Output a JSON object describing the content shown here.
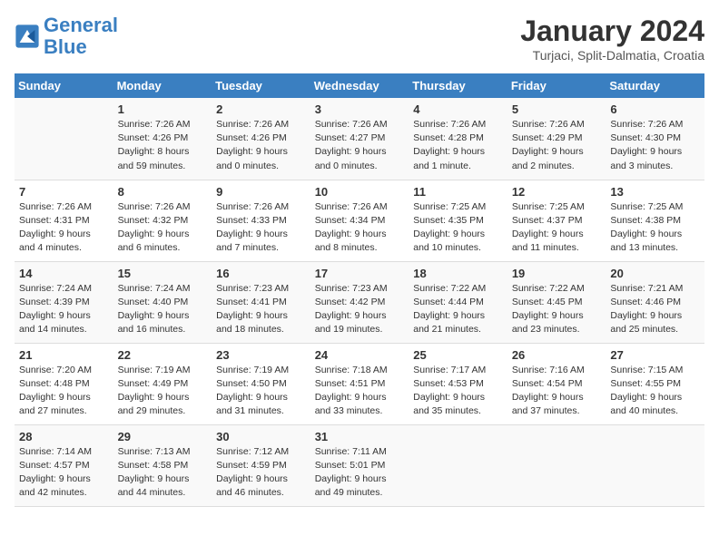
{
  "header": {
    "logo_line1": "General",
    "logo_line2": "Blue",
    "month": "January 2024",
    "location": "Turjaci, Split-Dalmatia, Croatia"
  },
  "days_of_week": [
    "Sunday",
    "Monday",
    "Tuesday",
    "Wednesday",
    "Thursday",
    "Friday",
    "Saturday"
  ],
  "weeks": [
    [
      {
        "day": "",
        "info": ""
      },
      {
        "day": "1",
        "info": "Sunrise: 7:26 AM\nSunset: 4:26 PM\nDaylight: 8 hours\nand 59 minutes."
      },
      {
        "day": "2",
        "info": "Sunrise: 7:26 AM\nSunset: 4:26 PM\nDaylight: 9 hours\nand 0 minutes."
      },
      {
        "day": "3",
        "info": "Sunrise: 7:26 AM\nSunset: 4:27 PM\nDaylight: 9 hours\nand 0 minutes."
      },
      {
        "day": "4",
        "info": "Sunrise: 7:26 AM\nSunset: 4:28 PM\nDaylight: 9 hours\nand 1 minute."
      },
      {
        "day": "5",
        "info": "Sunrise: 7:26 AM\nSunset: 4:29 PM\nDaylight: 9 hours\nand 2 minutes."
      },
      {
        "day": "6",
        "info": "Sunrise: 7:26 AM\nSunset: 4:30 PM\nDaylight: 9 hours\nand 3 minutes."
      }
    ],
    [
      {
        "day": "7",
        "info": "Sunrise: 7:26 AM\nSunset: 4:31 PM\nDaylight: 9 hours\nand 4 minutes."
      },
      {
        "day": "8",
        "info": "Sunrise: 7:26 AM\nSunset: 4:32 PM\nDaylight: 9 hours\nand 6 minutes."
      },
      {
        "day": "9",
        "info": "Sunrise: 7:26 AM\nSunset: 4:33 PM\nDaylight: 9 hours\nand 7 minutes."
      },
      {
        "day": "10",
        "info": "Sunrise: 7:26 AM\nSunset: 4:34 PM\nDaylight: 9 hours\nand 8 minutes."
      },
      {
        "day": "11",
        "info": "Sunrise: 7:25 AM\nSunset: 4:35 PM\nDaylight: 9 hours\nand 10 minutes."
      },
      {
        "day": "12",
        "info": "Sunrise: 7:25 AM\nSunset: 4:37 PM\nDaylight: 9 hours\nand 11 minutes."
      },
      {
        "day": "13",
        "info": "Sunrise: 7:25 AM\nSunset: 4:38 PM\nDaylight: 9 hours\nand 13 minutes."
      }
    ],
    [
      {
        "day": "14",
        "info": "Sunrise: 7:24 AM\nSunset: 4:39 PM\nDaylight: 9 hours\nand 14 minutes."
      },
      {
        "day": "15",
        "info": "Sunrise: 7:24 AM\nSunset: 4:40 PM\nDaylight: 9 hours\nand 16 minutes."
      },
      {
        "day": "16",
        "info": "Sunrise: 7:23 AM\nSunset: 4:41 PM\nDaylight: 9 hours\nand 18 minutes."
      },
      {
        "day": "17",
        "info": "Sunrise: 7:23 AM\nSunset: 4:42 PM\nDaylight: 9 hours\nand 19 minutes."
      },
      {
        "day": "18",
        "info": "Sunrise: 7:22 AM\nSunset: 4:44 PM\nDaylight: 9 hours\nand 21 minutes."
      },
      {
        "day": "19",
        "info": "Sunrise: 7:22 AM\nSunset: 4:45 PM\nDaylight: 9 hours\nand 23 minutes."
      },
      {
        "day": "20",
        "info": "Sunrise: 7:21 AM\nSunset: 4:46 PM\nDaylight: 9 hours\nand 25 minutes."
      }
    ],
    [
      {
        "day": "21",
        "info": "Sunrise: 7:20 AM\nSunset: 4:48 PM\nDaylight: 9 hours\nand 27 minutes."
      },
      {
        "day": "22",
        "info": "Sunrise: 7:19 AM\nSunset: 4:49 PM\nDaylight: 9 hours\nand 29 minutes."
      },
      {
        "day": "23",
        "info": "Sunrise: 7:19 AM\nSunset: 4:50 PM\nDaylight: 9 hours\nand 31 minutes."
      },
      {
        "day": "24",
        "info": "Sunrise: 7:18 AM\nSunset: 4:51 PM\nDaylight: 9 hours\nand 33 minutes."
      },
      {
        "day": "25",
        "info": "Sunrise: 7:17 AM\nSunset: 4:53 PM\nDaylight: 9 hours\nand 35 minutes."
      },
      {
        "day": "26",
        "info": "Sunrise: 7:16 AM\nSunset: 4:54 PM\nDaylight: 9 hours\nand 37 minutes."
      },
      {
        "day": "27",
        "info": "Sunrise: 7:15 AM\nSunset: 4:55 PM\nDaylight: 9 hours\nand 40 minutes."
      }
    ],
    [
      {
        "day": "28",
        "info": "Sunrise: 7:14 AM\nSunset: 4:57 PM\nDaylight: 9 hours\nand 42 minutes."
      },
      {
        "day": "29",
        "info": "Sunrise: 7:13 AM\nSunset: 4:58 PM\nDaylight: 9 hours\nand 44 minutes."
      },
      {
        "day": "30",
        "info": "Sunrise: 7:12 AM\nSunset: 4:59 PM\nDaylight: 9 hours\nand 46 minutes."
      },
      {
        "day": "31",
        "info": "Sunrise: 7:11 AM\nSunset: 5:01 PM\nDaylight: 9 hours\nand 49 minutes."
      },
      {
        "day": "",
        "info": ""
      },
      {
        "day": "",
        "info": ""
      },
      {
        "day": "",
        "info": ""
      }
    ]
  ]
}
